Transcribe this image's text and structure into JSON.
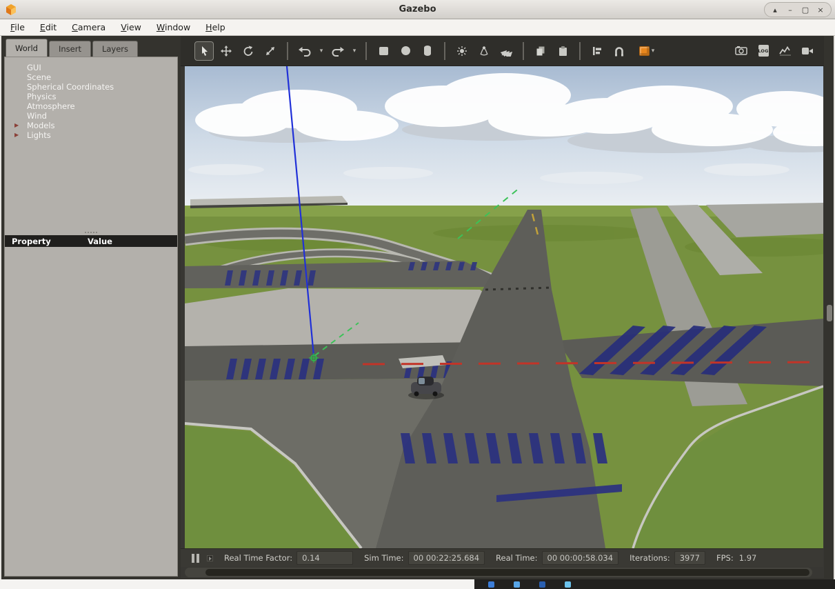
{
  "window": {
    "title": "Gazebo",
    "controls": [
      {
        "name": "shade",
        "glyph": "▴"
      },
      {
        "name": "minimize",
        "glyph": "–"
      },
      {
        "name": "maximize",
        "glyph": "▢"
      },
      {
        "name": "close",
        "glyph": "×"
      }
    ]
  },
  "menu": {
    "items": [
      {
        "accel": "F",
        "rest": "ile"
      },
      {
        "accel": "E",
        "rest": "dit"
      },
      {
        "accel": "C",
        "rest": "amera"
      },
      {
        "accel": "V",
        "rest": "iew"
      },
      {
        "accel": "W",
        "rest": "indow"
      },
      {
        "accel": "H",
        "rest": "elp"
      }
    ]
  },
  "left_panel": {
    "tabs": [
      {
        "label": "World",
        "active": true
      },
      {
        "label": "Insert",
        "active": false
      },
      {
        "label": "Layers",
        "active": false
      }
    ],
    "tree": [
      {
        "label": "GUI"
      },
      {
        "label": "Scene"
      },
      {
        "label": "Spherical Coordinates"
      },
      {
        "label": "Physics"
      },
      {
        "label": "Atmosphere"
      },
      {
        "label": "Wind"
      },
      {
        "label": "Models",
        "expandable": true
      },
      {
        "label": "Lights",
        "expandable": true
      }
    ],
    "expander_glyph": "▶",
    "property_table": {
      "property_header": "Property",
      "value_header": "Value"
    }
  },
  "toolbar": {
    "dropdown_glyph": "▾",
    "log_label": "LOG",
    "icons": [
      "select-tool",
      "translate-tool",
      "rotate-tool",
      "scale-tool",
      "undo",
      "redo",
      "box-shape",
      "sphere-shape",
      "cylinder-shape",
      "point-light",
      "spot-light",
      "directional-light",
      "copy",
      "paste",
      "align-tool",
      "snap-tool",
      "view-angle",
      "screenshot",
      "data-logger",
      "plot",
      "record-video"
    ]
  },
  "statusbar": {
    "real_time_factor_label": "Real Time Factor:",
    "real_time_factor_value": "0.14",
    "sim_time_label": "Sim Time:",
    "sim_time_value": "00 00:22:25.684",
    "real_time_label": "Real Time:",
    "real_time_value": "00 00:00:58.034",
    "iterations_label": "Iterations:",
    "iterations_value": "3977",
    "fps_label": "FPS:",
    "fps_value": "1.97"
  },
  "colors": {
    "accent_orange": "#e8871e",
    "sky": "#a8bbd2",
    "grass": "#76913f",
    "road": "#5b5b57",
    "marking_blue": "#2b3180",
    "marking_red": "#c23428",
    "trace_blue": "#2030d8",
    "trace_green": "#38c052"
  }
}
